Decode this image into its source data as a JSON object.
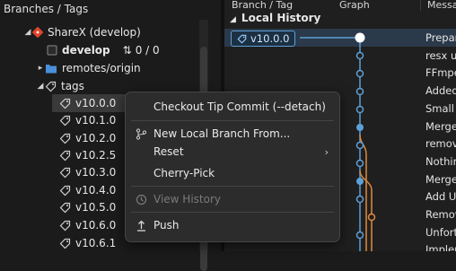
{
  "left_panel": {
    "title": "Branches / Tags",
    "repo": "ShareX (develop)",
    "current_branch": "develop",
    "current_branch_counts": "0 / 0",
    "remotes": "remotes/origin",
    "tags_label": "tags",
    "tags": [
      "v10.0.0",
      "v10.1.0",
      "v10.2.0",
      "v10.2.5",
      "v10.3.0",
      "v10.4.0",
      "v10.5.0",
      "v10.6.0",
      "v10.6.1"
    ]
  },
  "right_panel": {
    "col_branch_tag": "Branch / Tag",
    "col_graph": "Graph",
    "col_message": "Messa",
    "section": "Local History",
    "selected_tag": "v10.0.0",
    "messages": [
      "Prepar",
      "resx up",
      "FFmpe",
      "Added",
      "Small c",
      "Merge",
      "remov",
      "Nothin",
      "Merge",
      "Add U",
      "Remov",
      "Unfort",
      "Implen"
    ]
  },
  "context_menu": {
    "items": [
      {
        "label": "Checkout Tip Commit (--detach)",
        "icon": "",
        "enabled": true
      },
      {
        "label": "New Local Branch From...",
        "icon": "branch-icon",
        "enabled": true
      },
      {
        "label": "Reset",
        "icon": "",
        "enabled": true,
        "submenu": true
      },
      {
        "label": "Cherry-Pick",
        "icon": "",
        "enabled": true
      },
      {
        "label": "View History",
        "icon": "history-icon",
        "enabled": false
      },
      {
        "label": "Push",
        "icon": "push-icon",
        "enabled": true
      }
    ]
  },
  "colors": {
    "graph_blue": "#5da0d8",
    "graph_orange": "#e08a3c",
    "repo_red": "#e0452d",
    "folder_blue": "#4a90d9"
  }
}
